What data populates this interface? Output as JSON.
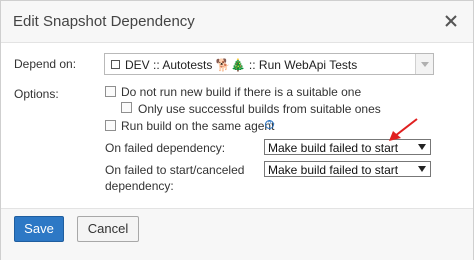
{
  "dialog": {
    "title": "Edit Snapshot Dependency"
  },
  "form": {
    "depend_on_label": "Depend on:",
    "depend_on_value": "DEV :: Autotests 🐕🎄 :: Run WebApi Tests",
    "options_label": "Options:",
    "options": [
      {
        "label": "Do not run new build if there is a suitable one",
        "checked": false
      },
      {
        "label": "Only use successful builds from suitable ones",
        "checked": false
      },
      {
        "label": "Run build on the same agent",
        "checked": false
      }
    ],
    "on_failed_label": "On failed dependency:",
    "on_failed_value": "Make build failed to start",
    "on_failed_start_label_line1": "On failed to start/canceled",
    "on_failed_start_label_line2": "dependency:",
    "on_failed_start_value": "Make build failed to start"
  },
  "footer": {
    "save_label": "Save",
    "cancel_label": "Cancel"
  },
  "colors": {
    "accent": "#2d78c5",
    "annotation_arrow": "#e02020"
  }
}
